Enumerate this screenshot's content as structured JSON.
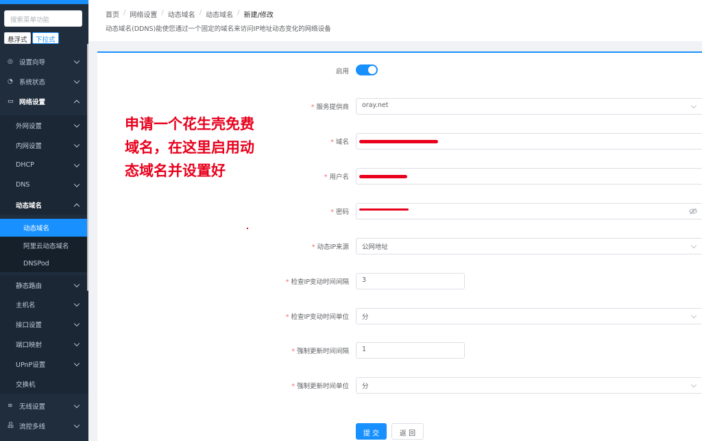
{
  "sidebar": {
    "search_placeholder": "搜索菜单功能",
    "mode_float": "悬浮式",
    "mode_dropdown": "下拉式",
    "items": [
      {
        "label": "设置向导",
        "icon": "compass-icon"
      },
      {
        "label": "系统状态",
        "icon": "dashboard-icon"
      },
      {
        "label": "网络设置",
        "icon": "monitor-icon"
      },
      {
        "label": "外网设置"
      },
      {
        "label": "内网设置"
      },
      {
        "label": "DHCP"
      },
      {
        "label": "DNS"
      },
      {
        "label": "动态域名"
      },
      {
        "label": "动态域名"
      },
      {
        "label": "阿里云动态域名"
      },
      {
        "label": "DNSPod"
      },
      {
        "label": "静态路由"
      },
      {
        "label": "主机名"
      },
      {
        "label": "接口设置"
      },
      {
        "label": "端口映射"
      },
      {
        "label": "UPnP设置"
      },
      {
        "label": "交换机"
      },
      {
        "label": "无线设置",
        "icon": "wifi-icon"
      },
      {
        "label": "流控多线",
        "icon": "network-icon"
      }
    ]
  },
  "header": {
    "breadcrumb": [
      "首页",
      "网络设置",
      "动态域名",
      "动态域名",
      "新建/修改"
    ],
    "separator": "/",
    "description": "动态域名(DDNS)能使您通过一个固定的域名来访问IP地址动态变化的网络设备"
  },
  "form": {
    "enable_label": "启用",
    "enable_on": true,
    "required_mark": "*",
    "provider_label": "服务提供商",
    "provider_value": "oray.net",
    "domain_label": "域名",
    "username_label": "用户名",
    "password_label": "密码",
    "ip_source_label": "动态IP来源",
    "ip_source_value": "公网地址",
    "check_interval_label": "检查IP变动时间间隔",
    "check_interval_value": "3",
    "check_unit_label": "检查IP变动时间单位",
    "check_unit_value": "分",
    "force_interval_label": "强制更新时间间隔",
    "force_interval_value": "1",
    "force_unit_label": "强制更新时间单位",
    "force_unit_value": "分",
    "submit_label": "提 交",
    "back_label": "返 回"
  },
  "annotation": {
    "line1": "申请一个花生壳免费",
    "line2": "域名，在这里启用动",
    "line3": "态域名并设置好"
  },
  "colors": {
    "accent": "#1890ff",
    "sidebar": "#1f2d3d",
    "annotation": "#e8001c"
  }
}
